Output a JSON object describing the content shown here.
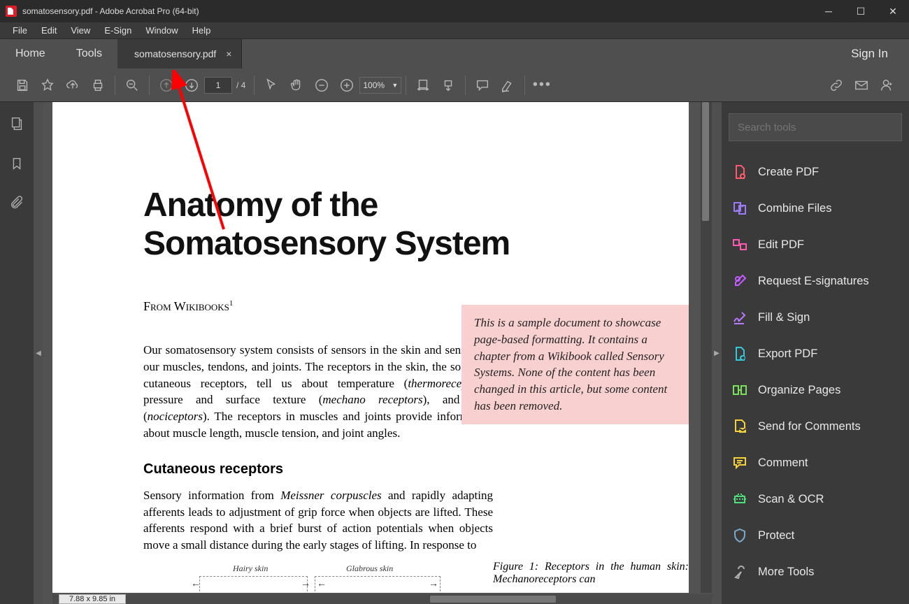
{
  "window": {
    "title": "somatosensory.pdf - Adobe Acrobat Pro (64-bit)"
  },
  "menu": [
    "File",
    "Edit",
    "View",
    "E-Sign",
    "Window",
    "Help"
  ],
  "tabs": {
    "home": "Home",
    "tools": "Tools",
    "doc": "somatosensory.pdf",
    "signin": "Sign In"
  },
  "toolbar": {
    "page_current": "1",
    "page_total": "/  4",
    "zoom": "100%"
  },
  "search": {
    "placeholder": "Search tools"
  },
  "tools_panel": [
    {
      "label": "Create PDF",
      "color": "#ff5b6c",
      "icon": "create"
    },
    {
      "label": "Combine Files",
      "color": "#9b7bf7",
      "icon": "combine"
    },
    {
      "label": "Edit PDF",
      "color": "#ff5bb0",
      "icon": "edit"
    },
    {
      "label": "Request E-signatures",
      "color": "#c65bff",
      "icon": "sign"
    },
    {
      "label": "Fill & Sign",
      "color": "#b87bff",
      "icon": "fill"
    },
    {
      "label": "Export PDF",
      "color": "#35c8d8",
      "icon": "export"
    },
    {
      "label": "Organize Pages",
      "color": "#7be05b",
      "icon": "organize"
    },
    {
      "label": "Send for Comments",
      "color": "#f5d23b",
      "icon": "send"
    },
    {
      "label": "Comment",
      "color": "#f5d23b",
      "icon": "comment"
    },
    {
      "label": "Scan & OCR",
      "color": "#4be07b",
      "icon": "scan"
    },
    {
      "label": "Protect",
      "color": "#7aa8c8",
      "icon": "protect"
    },
    {
      "label": "More Tools",
      "color": "#b0b0b0",
      "icon": "more"
    }
  ],
  "document": {
    "title": "Anatomy of the Somatosensory System",
    "subtitle": "From Wikibooks",
    "sup": "1",
    "para1a": "Our somatosensory system consists of sensors in the skin and sensors in our muscles, tendons, and joints. The re­ceptors in the skin, the so called cutaneous receptors, tell us about temperature (",
    "para1b": "thermoreceptors",
    "para1c": "), pressure and sur­face texture (",
    "para1d": "mechano receptors",
    "para1e": "), and pain (",
    "para1f": "nociceptors",
    "para1g": "). The receptors in muscles and joints provide information about muscle length, muscle tension, and joint angles.",
    "h2": "Cutaneous receptors",
    "para2a": "Sensory information from ",
    "para2b": "Meissner corpuscles",
    "para2c": " and rapidly adapting afferents leads to adjustment of grip force when objects are lifted. These afferents respond with a brief burst of action potentials when objects move a small dis­tance during the early stages of lifting. In response to",
    "callout": "This is a sample document to showcase page-based formatting. It contains a chapter from a Wikibook called Sensory Systems. None of the content has been changed in this article, but some content has been removed.",
    "fig": "Figure 1:  Receptors in the hu­man skin: Mechanoreceptors can",
    "skin_hairy": "Hairy skin",
    "skin_glabrous": "Glabrous skin"
  },
  "status": {
    "dimensions": "7.88 x 9.85 in"
  }
}
